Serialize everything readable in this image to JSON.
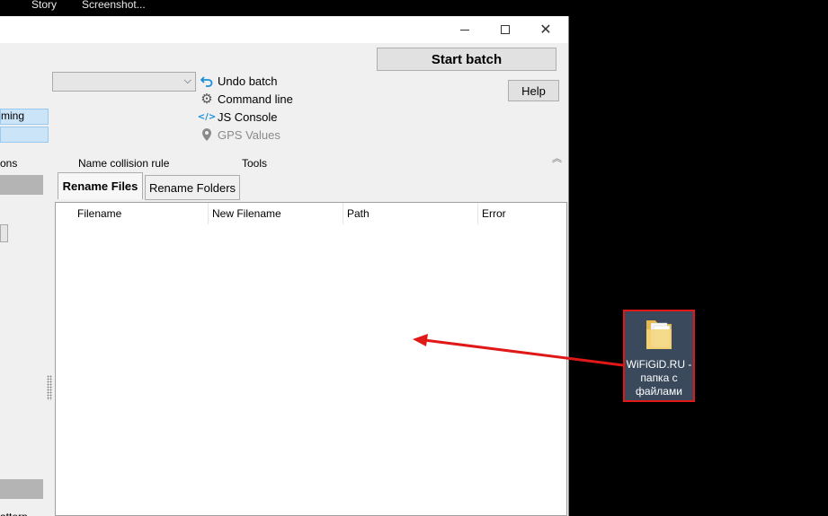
{
  "taskbar": {
    "items": [
      "Story",
      "Screenshot..."
    ]
  },
  "toolbar": {
    "start_batch": "Start batch",
    "help": "Help",
    "undo_batch": "Undo batch",
    "command_line": "Command line",
    "js_console": "JS Console",
    "gps_values": "GPS Values",
    "combo_value": ""
  },
  "left_panel": {
    "item_1": "ming",
    "label_1": "ons",
    "bottom_text": "attern"
  },
  "section_labels": {
    "name_collision_rule": "Name collision rule",
    "tools": "Tools"
  },
  "tabs": {
    "rename_files": "Rename Files",
    "rename_folders": "Rename Folders"
  },
  "list": {
    "columns": [
      "Filename",
      "New Filename",
      "Path",
      "Error"
    ],
    "rows": []
  },
  "desktop_icon": {
    "label": "WiFiGiD.RU - папка с файлами",
    "icon": "folder-icon"
  },
  "colors": {
    "highlight": "#e01818",
    "selection": "#cce4f7",
    "accent_icon": "#1c8fd8"
  }
}
